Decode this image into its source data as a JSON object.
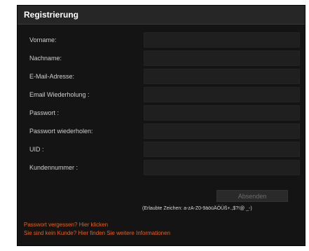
{
  "panel": {
    "title": "Registrierung"
  },
  "form": {
    "fields": [
      {
        "label": "Vorname:",
        "value": ""
      },
      {
        "label": "Nachname:",
        "value": ""
      },
      {
        "label": "E-Mail-Adresse:",
        "value": ""
      },
      {
        "label": "Email Wiederholung :",
        "value": ""
      },
      {
        "label": "Passwort :",
        "value": ""
      },
      {
        "label": "Passwort wiederholen:",
        "value": ""
      },
      {
        "label": "UID :",
        "value": ""
      },
      {
        "label": "Kundennummer :",
        "value": ""
      }
    ],
    "submit_label": "Absenden",
    "allowed_chars_hint": "(Erlaubte Zeichen: a-zA-Z0-9äöüÄÖÜß+.,$?!@ _-)"
  },
  "links": {
    "forgot_password": "Passwort vergessen? Hier klicken",
    "not_customer": "Sie sind kein Kunde? Hier finden Sie weitere Informationen"
  },
  "colors": {
    "panel_bg": "#141414",
    "header_bg": "#262626",
    "link": "#e8610f"
  }
}
